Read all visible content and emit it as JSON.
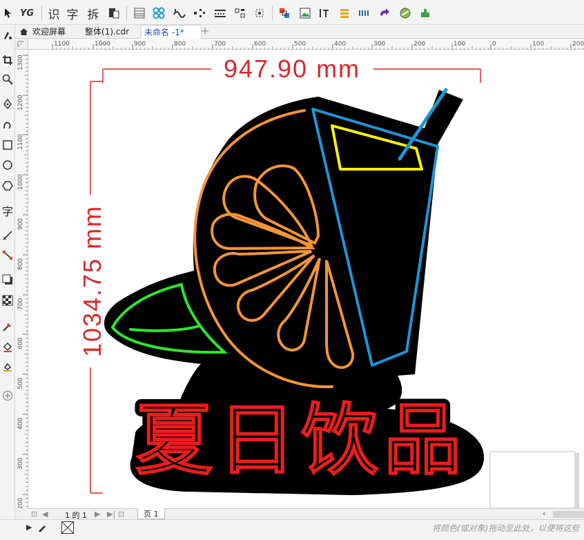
{
  "tabs": [
    {
      "label": "欢迎屏幕"
    },
    {
      "label": "整体(1).cdr"
    },
    {
      "label": "未命名 -1*"
    }
  ],
  "toolbar": {
    "text_tool_1": "识",
    "text_tool_2": "字",
    "text_tool_3": "拆"
  },
  "left_toolbox": {
    "text_tool_label": "字"
  },
  "ruler": {
    "h_ticks": [
      "1100",
      "1000",
      "900",
      "800",
      "700",
      "600",
      "500",
      "400",
      "300",
      "200",
      "100",
      "0",
      "100",
      "200"
    ],
    "v_ticks": [
      "1300",
      "1200",
      "1100",
      "1000",
      "900",
      "800",
      "700",
      "600",
      "500",
      "400",
      "300",
      "200"
    ]
  },
  "dimensions": {
    "width": "947.90 mm",
    "height": "1034.75 mm"
  },
  "artwork": {
    "title": "夏日饮品"
  },
  "status": {
    "page_label": "1 的 1",
    "page_tab": "页 1",
    "hint": "将颜色(或对象)拖动至此处，以便将这些"
  },
  "colors": {
    "dimension": "#d9282a",
    "orange": "#f39536",
    "blue": "#1e95d8",
    "yellow": "#fff200",
    "green": "#2ee62c",
    "red": "#ee1c1c",
    "artboard_bg": "#000000"
  }
}
